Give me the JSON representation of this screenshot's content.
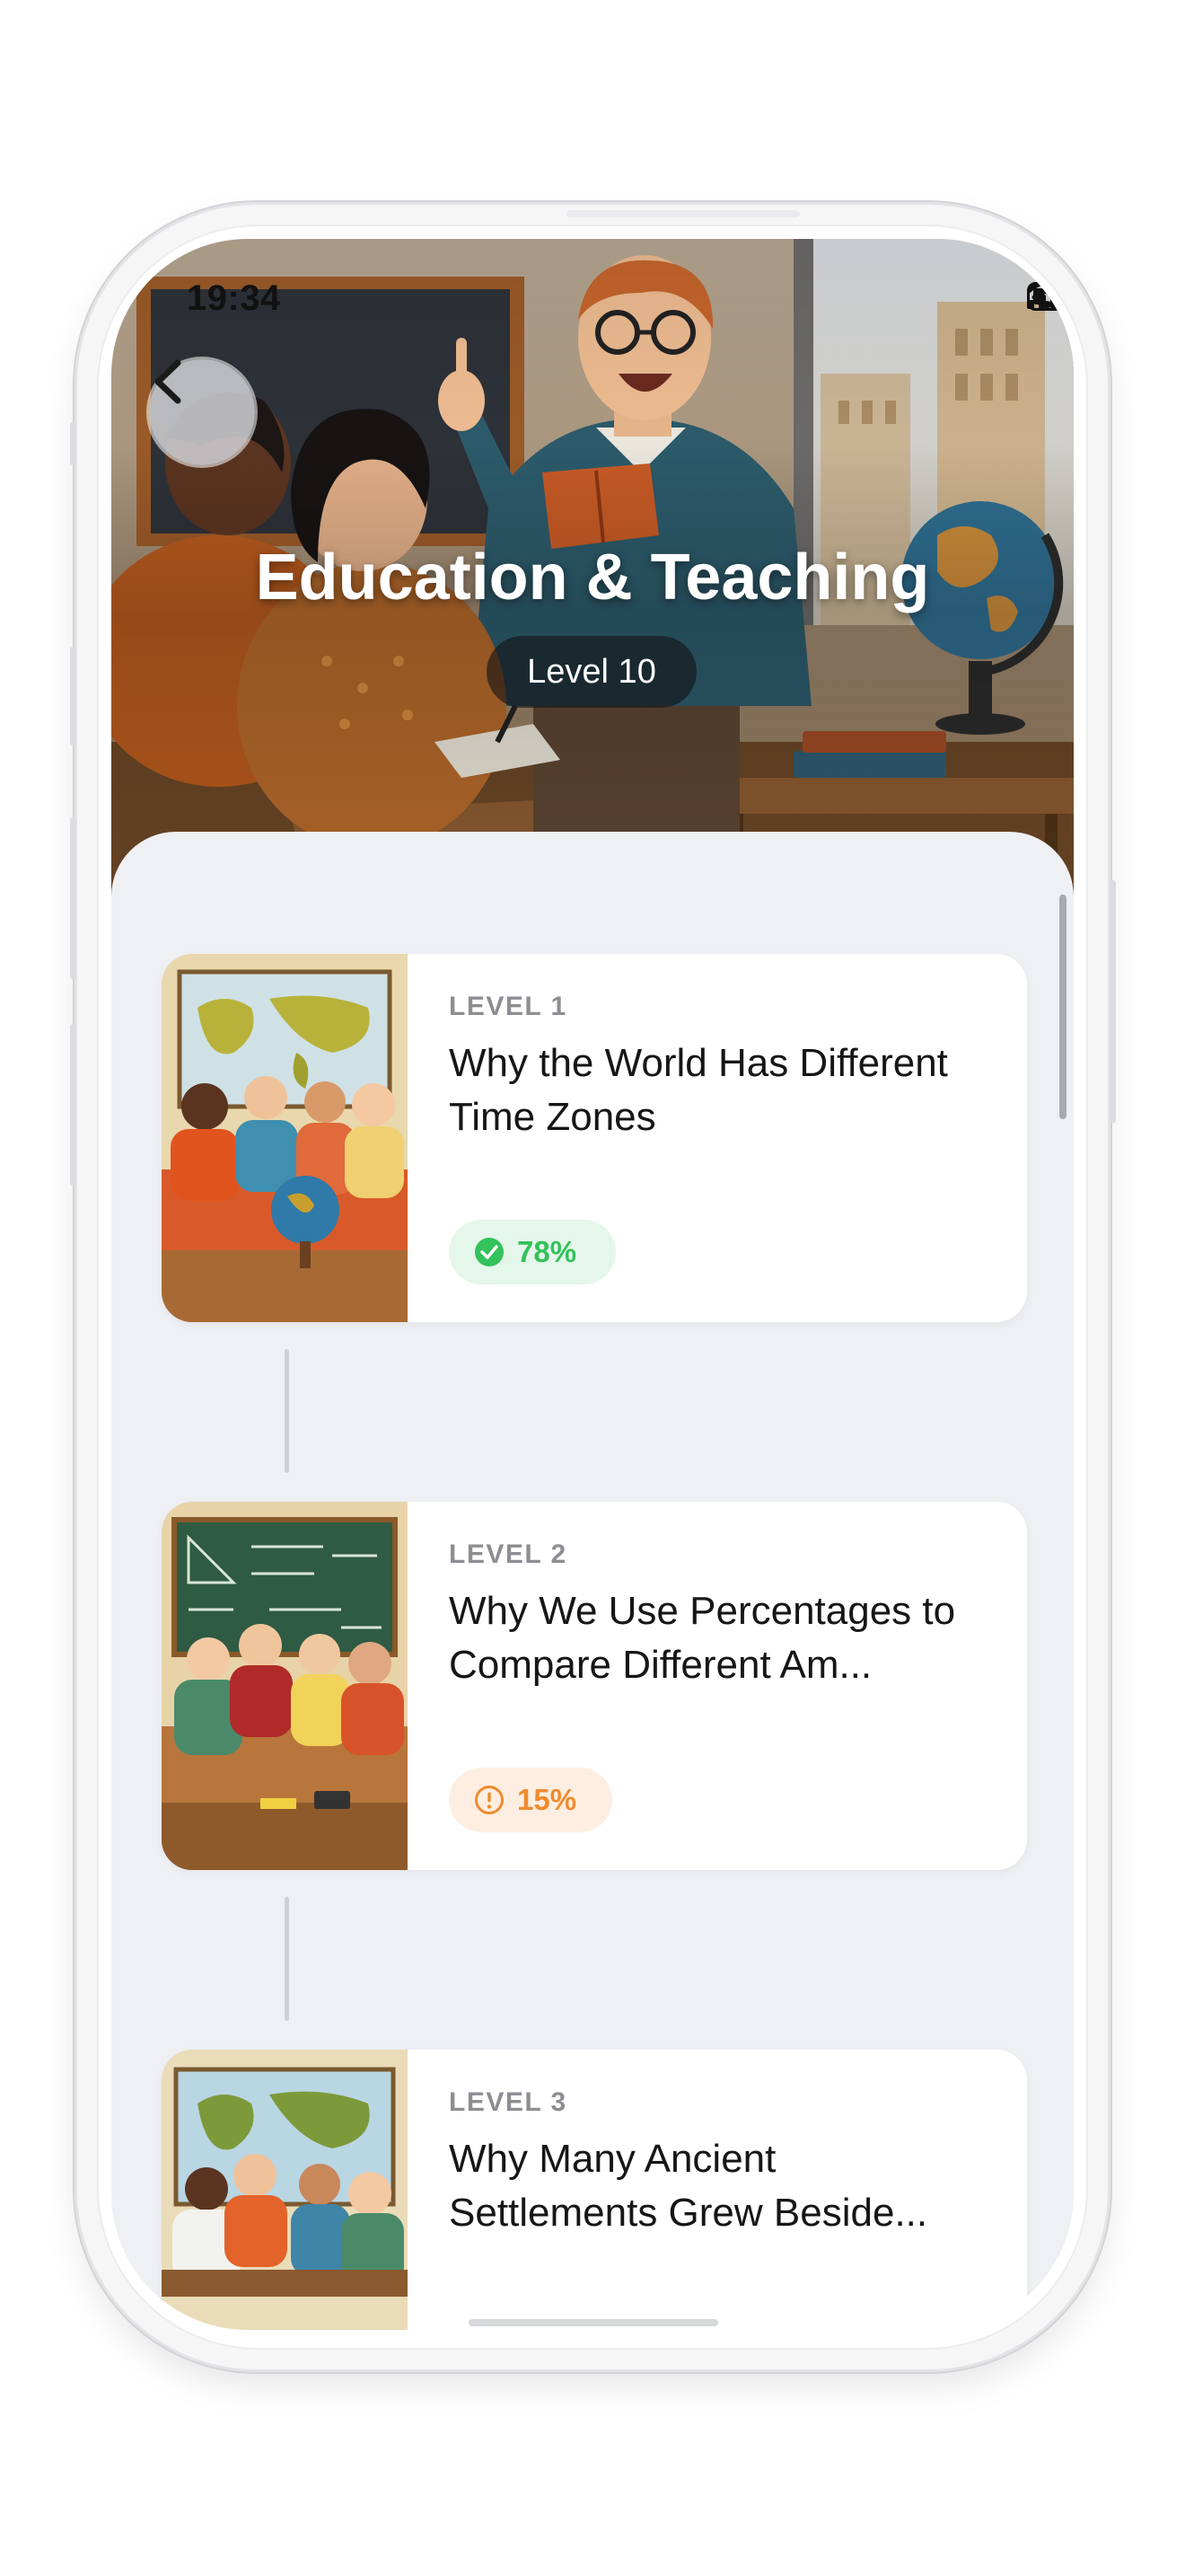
{
  "status_bar": {
    "time": "19:34",
    "icons": [
      "signal-icon",
      "wifi-icon",
      "battery-icon"
    ]
  },
  "header": {
    "back_icon": "chevron-left-icon",
    "title": "Education & Teaching",
    "level_badge": "Level 10"
  },
  "lessons": [
    {
      "level": "LEVEL 1",
      "title": "Why the World Has Different Time Zones",
      "score": "78%",
      "status": "passed",
      "status_icon": "check-circle-icon",
      "status_color": "#33c25b"
    },
    {
      "level": "LEVEL 2",
      "title": "Why We Use Percentages to Compare Different Am...",
      "score": "15%",
      "status": "warning",
      "status_icon": "alert-circle-icon",
      "status_color": "#ef8b2e"
    },
    {
      "level": "LEVEL 3",
      "title": "Why Many Ancient Settlements Grew Beside...",
      "score": "",
      "status": "",
      "status_icon": "",
      "status_color": ""
    }
  ],
  "colors": {
    "background": "#eff0f4",
    "card": "#ffffff",
    "success": "#33c25b",
    "warning": "#ef8b2e"
  }
}
